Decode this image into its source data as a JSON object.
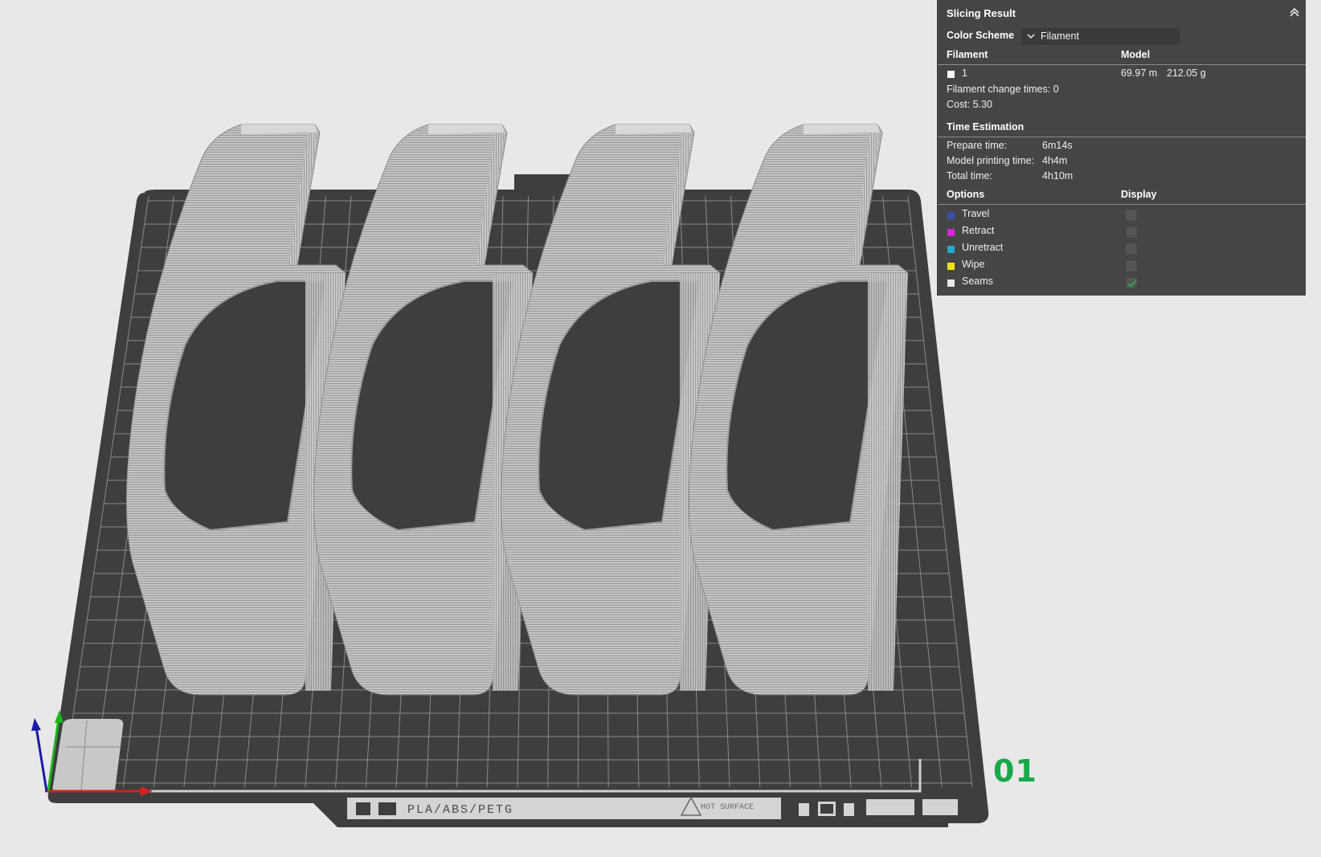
{
  "panel": {
    "title": "Slicing Result",
    "color_scheme_label": "Color Scheme",
    "color_scheme_value": "Filament",
    "filament_header": "Filament",
    "model_header": "Model",
    "filament_row": {
      "index": "1",
      "length": "69.97 m",
      "weight": "212.05 g",
      "color": "#ffffff"
    },
    "filament_change": "Filament change times:  0",
    "cost": "Cost:  5.30",
    "time_header": "Time Estimation",
    "prepare_label": "Prepare time:",
    "prepare_value": "6m14s",
    "model_time_label": "Model printing time:",
    "model_time_value": "4h4m",
    "total_label": "Total time:",
    "total_value": "4h10m",
    "options_header": "Options",
    "display_header": "Display",
    "options": [
      {
        "label": "Travel",
        "color": "#3a4fa8",
        "checked": false
      },
      {
        "label": "Retract",
        "color": "#d426d4",
        "checked": false
      },
      {
        "label": "Unretract",
        "color": "#29a6c9",
        "checked": false
      },
      {
        "label": "Wipe",
        "color": "#f0e21a",
        "checked": false
      },
      {
        "label": "Seams",
        "color": "#e8e8e8",
        "checked": true
      }
    ]
  },
  "plate": {
    "number": "01",
    "label": "PLA/ABS/PETG",
    "warning": "HOT SURFACE",
    "colors": {
      "bed": "#3e3e3e",
      "grid": "#8a8a8a",
      "print": "#b8b8b8"
    }
  },
  "axes": {
    "x_color": "#d62020",
    "y_color": "#1fb21f",
    "z_color": "#1a1aa8"
  }
}
